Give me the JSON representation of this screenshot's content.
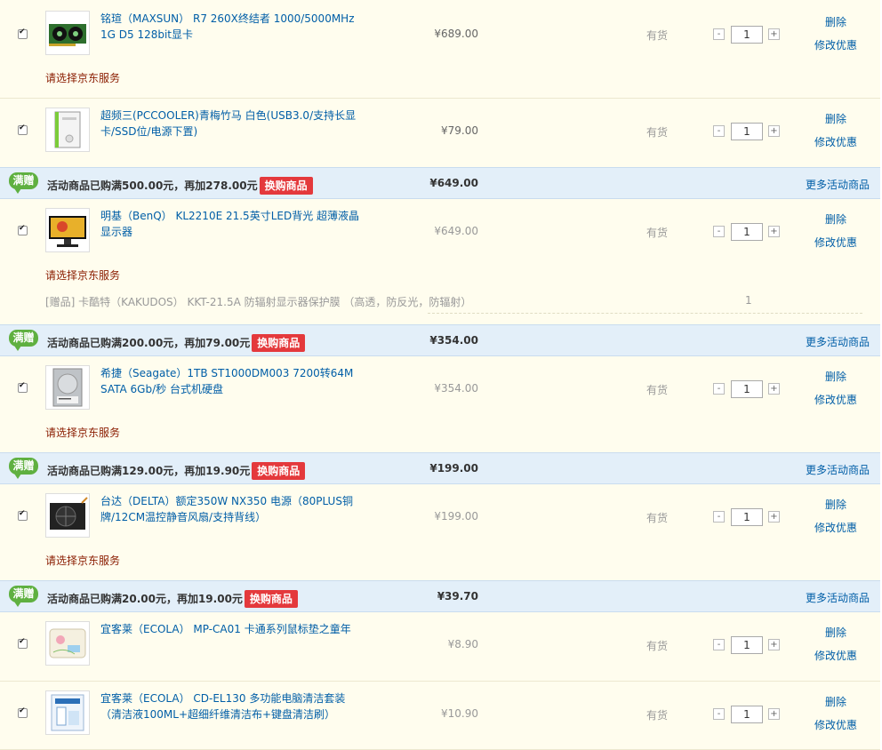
{
  "actions": {
    "delete": "删除",
    "modify_promo": "修改优惠"
  },
  "service_label": "请选择京东服务",
  "stock_label": "有货",
  "swap_label": "换购商品",
  "badge_label": "满赠",
  "more_label": "更多活动商品",
  "qty_minus": "-",
  "qty_plus": "+",
  "items": [
    {
      "title": "铭瑄（MAXSUN） R7 260X终结者 1000/5000MHz 1G D5 128bit显卡",
      "price": "¥689.00",
      "qty": "1"
    },
    {
      "title": "超频三(PCCOOLER)青梅竹马 白色(USB3.0/支持长显卡/SSD位/电源下置)",
      "price": "¥79.00",
      "qty": "1"
    },
    {
      "title": "明基（BenQ） KL2210E 21.5英寸LED背光 超薄液晶显示器",
      "price": "¥649.00",
      "qty": "1"
    },
    {
      "title": "希捷（Seagate）1TB ST1000DM003 7200转64M SATA 6Gb/秒 台式机硬盘",
      "price": "¥354.00",
      "qty": "1"
    },
    {
      "title": "台达（DELTA）额定350W NX350 电源（80PLUS铜牌/12CM温控静音风扇/支持背线）",
      "price": "¥199.00",
      "qty": "1"
    },
    {
      "title": "宜客莱（ECOLA） MP-CA01 卡通系列鼠标垫之童年",
      "price": "¥8.90",
      "qty": "1"
    },
    {
      "title": "宜客莱（ECOLA） CD-EL130 多功能电脑清洁套装（清洁液100ML+超细纤维清洁布+键盘清洁刷）",
      "price": "¥10.90",
      "qty": "1"
    }
  ],
  "gift": {
    "text": "[赠品] 卡酷特（KAKUDOS） KKT-21.5A 防辐射显示器保护膜 （高透，防反光，防辐射）",
    "qty": "1"
  },
  "promos": [
    {
      "text": "活动商品已购满500.00元，再加278.00元",
      "total": "¥649.00"
    },
    {
      "text": "活动商品已购满200.00元，再加79.00元",
      "total": "¥354.00"
    },
    {
      "text": "活动商品已购满129.00元，再加19.90元",
      "total": "¥199.00"
    },
    {
      "text": "活动商品已购满20.00元，再加19.00元",
      "total": "¥39.70"
    }
  ]
}
